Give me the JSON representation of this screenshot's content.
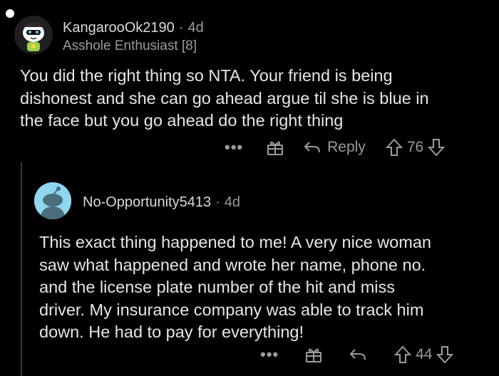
{
  "comments": [
    {
      "username": "KangarooOk2190",
      "separator": "·",
      "age": "4d",
      "flair": "Asshole Enthusiast [8]",
      "body": "You did the right thing so NTA. Your friend is being\ndishonest and she can go ahead argue til she is blue in\nthe face but you go ahead do the right thing",
      "more": "•••",
      "reply_label": "Reply",
      "score": "76",
      "icons": [
        "more-icon",
        "award-icon",
        "reply-icon",
        "upvote-icon",
        "downvote-icon"
      ]
    },
    {
      "username": "No-Opportunity5413",
      "separator": "·",
      "age": "4d",
      "body": "This exact thing happened to me!  A very nice woman\nsaw what happened and wrote her name, phone no.\nand the license plate number of the hit and miss\ndriver.  My insurance company was able to track him\ndown.  He had to pay for everything!",
      "more": "•••",
      "score": "44",
      "icons": [
        "more-icon",
        "award-icon",
        "reply-icon",
        "upvote-icon",
        "downvote-icon"
      ]
    }
  ],
  "colors": {
    "background": "#000000",
    "text": "#e6e6e6",
    "meta": "#9a9c9e",
    "thread_line": "#343536",
    "avatar2_bg": "#8fd6ef"
  }
}
